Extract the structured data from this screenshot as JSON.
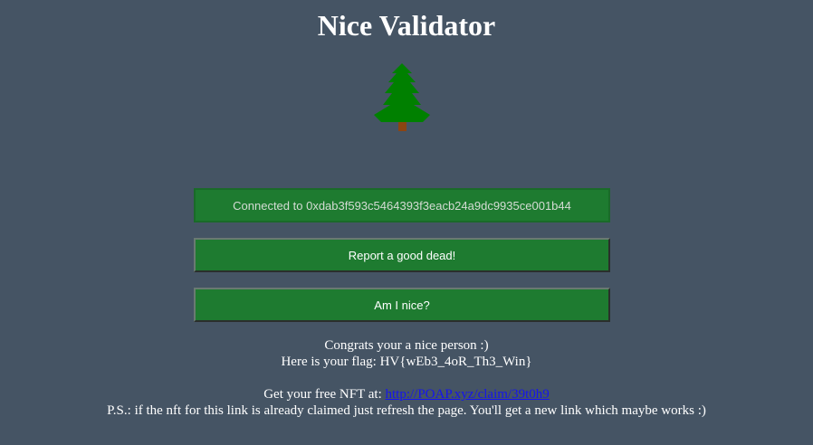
{
  "header": {
    "title": "Nice Validator"
  },
  "buttons": {
    "connected_label": "Connected to 0xdab3f593c5464393f3eacb24a9dc9935ce001b44",
    "report_label": "Report a good dead!",
    "nice_label": "Am I nice?"
  },
  "result": {
    "congrats": "Congrats your a nice person :)",
    "flag_line": "Here is your flag: HV{wEb3_4oR_Th3_Win}",
    "nft_prefix": "Get your free NFT at:",
    "nft_link": "http://POAP.xyz/claim/39t0h9",
    "ps": "P.S.: if the nft for this link is already claimed just refresh the page. You'll get a new link which maybe works :)"
  },
  "colors": {
    "background": "#455464",
    "button": "#1e7b30",
    "tree": "#008000",
    "trunk": "#8b4513",
    "link": "#1414ee"
  },
  "icons": {
    "tree": "christmas-tree-icon"
  }
}
